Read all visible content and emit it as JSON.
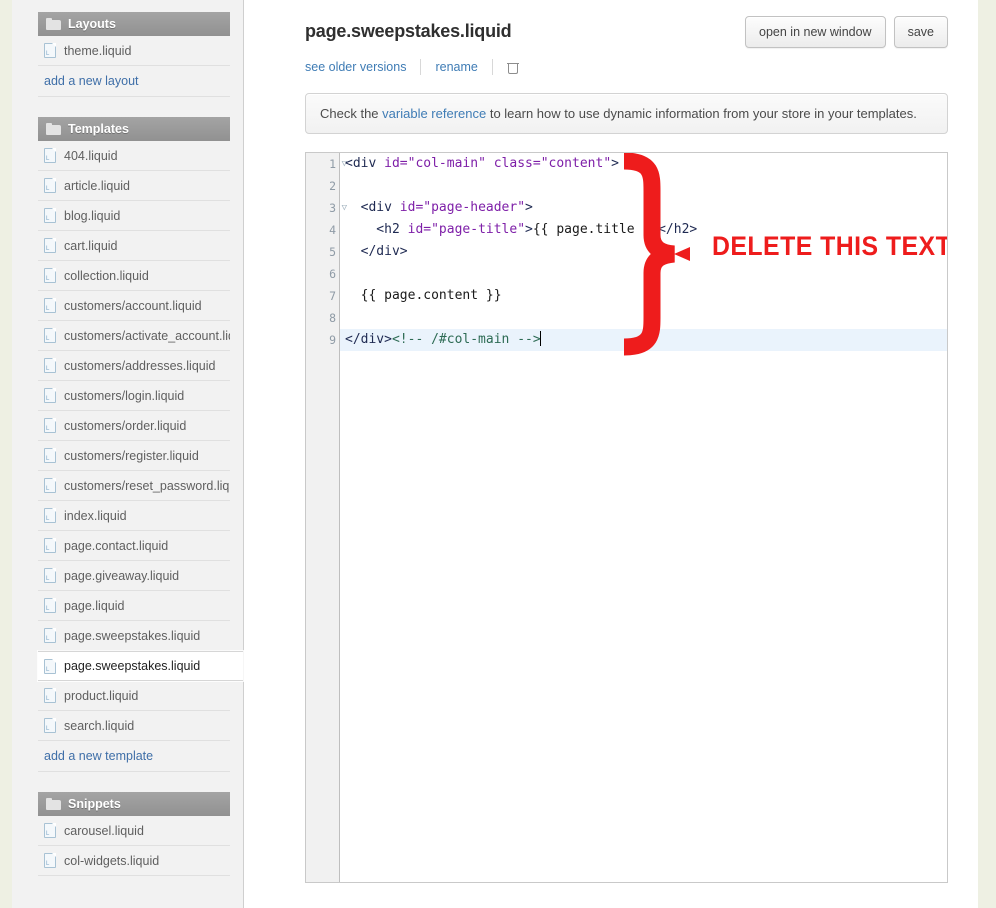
{
  "sidebar": {
    "groups": [
      {
        "title": "Layouts",
        "icon": "folder-icon",
        "files": [
          {
            "name": "theme.liquid",
            "selected": false
          }
        ],
        "add_label": "add a new layout"
      },
      {
        "title": "Templates",
        "icon": "folder-icon",
        "files": [
          {
            "name": "404.liquid",
            "selected": false
          },
          {
            "name": "article.liquid",
            "selected": false
          },
          {
            "name": "blog.liquid",
            "selected": false
          },
          {
            "name": "cart.liquid",
            "selected": false
          },
          {
            "name": "collection.liquid",
            "selected": false
          },
          {
            "name": "customers/account.liquid",
            "selected": false
          },
          {
            "name": "customers/activate_account.liquid",
            "selected": false
          },
          {
            "name": "customers/addresses.liquid",
            "selected": false
          },
          {
            "name": "customers/login.liquid",
            "selected": false
          },
          {
            "name": "customers/order.liquid",
            "selected": false
          },
          {
            "name": "customers/register.liquid",
            "selected": false
          },
          {
            "name": "customers/reset_password.liquid",
            "selected": false
          },
          {
            "name": "index.liquid",
            "selected": false
          },
          {
            "name": "page.contact.liquid",
            "selected": false
          },
          {
            "name": "page.giveaway.liquid",
            "selected": false
          },
          {
            "name": "page.liquid",
            "selected": false
          },
          {
            "name": "page.sweepstakes.liquid",
            "selected": false
          },
          {
            "name": "page.sweepstakes.liquid",
            "selected": true
          },
          {
            "name": "product.liquid",
            "selected": false
          },
          {
            "name": "search.liquid",
            "selected": false
          }
        ],
        "add_label": "add a new template"
      },
      {
        "title": "Snippets",
        "icon": "folder-icon",
        "files": [
          {
            "name": "carousel.liquid",
            "selected": false
          },
          {
            "name": "col-widgets.liquid",
            "selected": false
          }
        ],
        "add_label": ""
      }
    ]
  },
  "header": {
    "file_title": "page.sweepstakes.liquid",
    "open_in_new_window_label": "open in new window",
    "save_label": "save",
    "see_older_versions_label": "see older versions",
    "rename_label": "rename",
    "delete_icon": "trash-icon"
  },
  "notice": {
    "text_before": "Check the ",
    "link": "variable reference",
    "text_after": " to learn how to use dynamic information from your store in your templates."
  },
  "editor": {
    "lines": [
      {
        "num": "1",
        "fold": "▽",
        "active": false,
        "tokens": [
          {
            "t": "<div ",
            "c": "tk-tag"
          },
          {
            "t": "id=",
            "c": "tk-attr"
          },
          {
            "t": "\"col-main\"",
            "c": "tk-val"
          },
          {
            "t": " ",
            "c": "tk-tag"
          },
          {
            "t": "class=",
            "c": "tk-attr"
          },
          {
            "t": "\"content\"",
            "c": "tk-val"
          },
          {
            "t": ">",
            "c": "tk-tag"
          }
        ]
      },
      {
        "num": "2",
        "fold": "",
        "active": false,
        "tokens": []
      },
      {
        "num": "3",
        "fold": "▽",
        "active": false,
        "tokens": [
          {
            "t": "  <div ",
            "c": "tk-tag"
          },
          {
            "t": "id=",
            "c": "tk-attr"
          },
          {
            "t": "\"page-header\"",
            "c": "tk-val"
          },
          {
            "t": ">",
            "c": "tk-tag"
          }
        ]
      },
      {
        "num": "4",
        "fold": "",
        "active": false,
        "tokens": [
          {
            "t": "    <h2 ",
            "c": "tk-tag"
          },
          {
            "t": "id=",
            "c": "tk-attr"
          },
          {
            "t": "\"page-title\"",
            "c": "tk-val"
          },
          {
            "t": ">",
            "c": "tk-tag"
          },
          {
            "t": "{{ page.title }}",
            "c": "tk-liquid"
          },
          {
            "t": "</h2>",
            "c": "tk-tag"
          }
        ]
      },
      {
        "num": "5",
        "fold": "",
        "active": false,
        "tokens": [
          {
            "t": "  </div>",
            "c": "tk-tag"
          }
        ]
      },
      {
        "num": "6",
        "fold": "",
        "active": false,
        "tokens": []
      },
      {
        "num": "7",
        "fold": "",
        "active": false,
        "tokens": [
          {
            "t": "  {{ page.content }}",
            "c": "tk-liquid"
          }
        ]
      },
      {
        "num": "8",
        "fold": "",
        "active": false,
        "tokens": []
      },
      {
        "num": "9",
        "fold": "",
        "active": true,
        "tokens": [
          {
            "t": "</div>",
            "c": "tk-tag"
          },
          {
            "t": "<!-- /#col-main -->",
            "c": "tk-cmt"
          }
        ]
      }
    ]
  },
  "annotation": {
    "text": "DELETE THIS TEXT",
    "color": "#ee1c1c",
    "shape": "right-curly-brace"
  },
  "colors": {
    "page_background": "#eef0e3",
    "sidebar_background": "#f2f2f2",
    "group_header": "#9a9a9a",
    "link": "#3f7cb5",
    "annotation_red": "#ee1c1c",
    "active_line": "#eaf3fc"
  }
}
